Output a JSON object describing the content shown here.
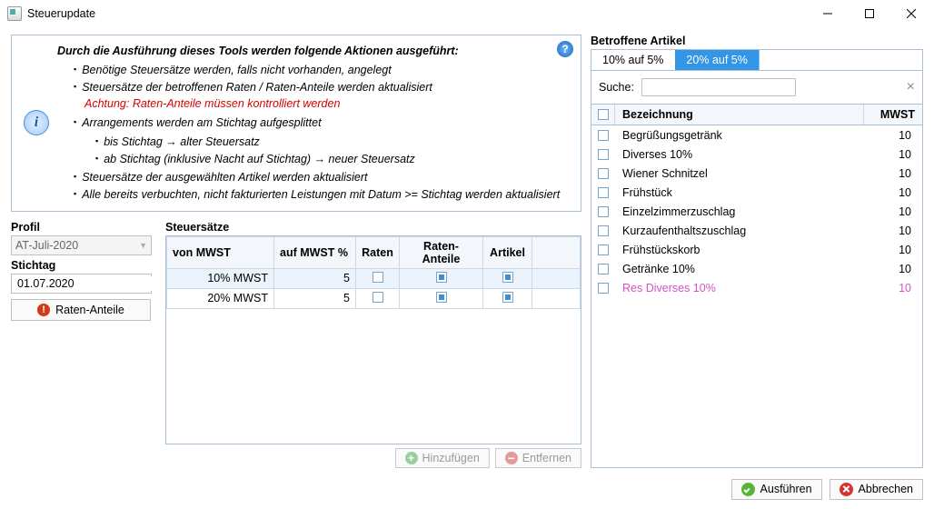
{
  "window": {
    "title": "Steuerupdate"
  },
  "info": {
    "heading": "Durch die Ausführung dieses Tools werden folgende Aktionen ausgeführt:",
    "b1": "Benötige Steuersätze werden, falls nicht vorhanden, angelegt",
    "b2": "Steuersätze der betroffenen Raten / Raten-Anteile werden aktualisiert",
    "warn": "Achtung: Raten-Anteile müssen kontrolliert werden",
    "b3": "Arrangements werden am Stichtag aufgesplittet",
    "b3a": "bis Stichtag → alter Steuersatz",
    "b3b": "ab Stichtag (inklusive Nacht auf Stichtag) → neuer Steuersatz",
    "b4": "Steuersätze der ausgewählten Artikel werden aktualisiert",
    "b5": "Alle bereits verbuchten, nicht fakturierten Leistungen mit Datum >= Stichtag werden aktualisiert"
  },
  "sidebar": {
    "profil_label": "Profil",
    "profil_value": "AT-Juli-2020",
    "stichtag_label": "Stichtag",
    "stichtag_value": "01.07.2020",
    "ratenanteile_btn": "Raten-Anteile"
  },
  "grid": {
    "heading": "Steuersätze",
    "headers": {
      "von": "von MWST",
      "auf": "auf MWST %",
      "raten": "Raten",
      "anteile": "Raten-Anteile",
      "artikel": "Artikel"
    },
    "rows": [
      {
        "von": "10% MWST",
        "auf": "5",
        "raten": false,
        "anteile": true,
        "artikel": true,
        "selected": true
      },
      {
        "von": "20% MWST",
        "auf": "5",
        "raten": false,
        "anteile": true,
        "artikel": true,
        "selected": false
      }
    ],
    "add_btn": "Hinzufügen",
    "remove_btn": "Entfernen"
  },
  "right": {
    "heading": "Betroffene Artikel",
    "tabs": [
      {
        "label": "10% auf 5%",
        "active": true
      },
      {
        "label": "20% auf 5%",
        "active": false
      }
    ],
    "search_label": "Suche:",
    "col_bezeichnung": "Bezeichnung",
    "col_mwst": "MWST",
    "rows": [
      {
        "name": "Begrüßungsgetränk",
        "mwst": "10",
        "res": false
      },
      {
        "name": "Diverses 10%",
        "mwst": "10",
        "res": false
      },
      {
        "name": "Wiener Schnitzel",
        "mwst": "10",
        "res": false
      },
      {
        "name": "Frühstück",
        "mwst": "10",
        "res": false
      },
      {
        "name": "Einzelzimmerzuschlag",
        "mwst": "10",
        "res": false
      },
      {
        "name": "Kurzaufenthaltszuschlag",
        "mwst": "10",
        "res": false
      },
      {
        "name": "Frühstückskorb",
        "mwst": "10",
        "res": false
      },
      {
        "name": "Getränke 10%",
        "mwst": "10",
        "res": false
      },
      {
        "name": "Res Diverses 10%",
        "mwst": "10",
        "res": true
      }
    ]
  },
  "footer": {
    "ok": "Ausführen",
    "cancel": "Abbrechen"
  }
}
